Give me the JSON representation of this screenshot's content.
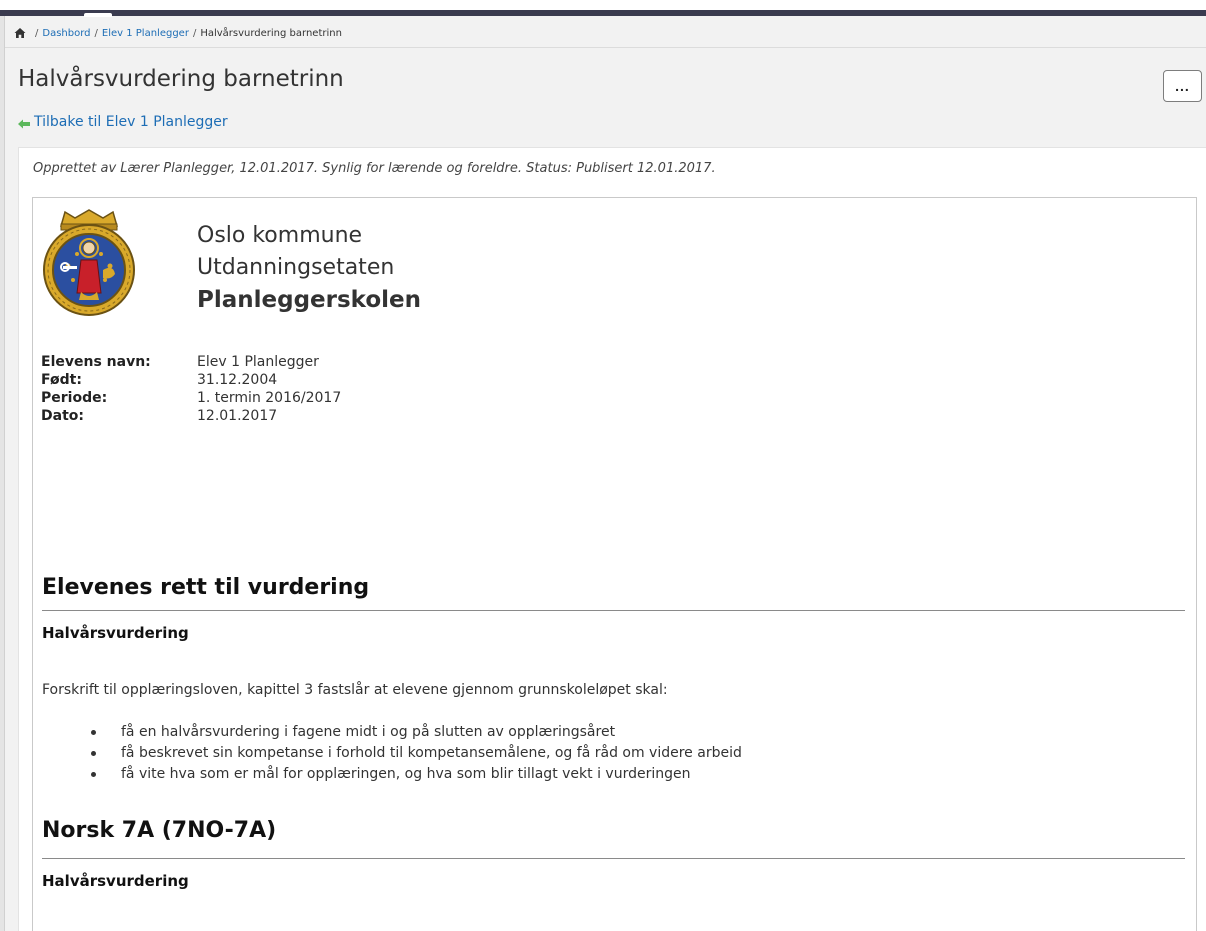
{
  "breadcrumb": {
    "items": [
      "Dashbord",
      "Elev 1 Planlegger"
    ],
    "separator": "/",
    "current": "Halvårsvurdering barnetrinn"
  },
  "page": {
    "title": "Halvårsvurdering barnetrinn",
    "more_label": "...",
    "back_link": "Tilbake til Elev 1 Planlegger"
  },
  "meta": "Opprettet av Lærer Planlegger, 12.01.2017. Synlig for lærende og foreldre. Status: Publisert 12.01.2017.",
  "document": {
    "org": [
      "Oslo kommune",
      "Utdanningsetaten"
    ],
    "school": "Planleggerskolen",
    "info": [
      {
        "label": "Elevens navn:",
        "value": "Elev 1 Planlegger"
      },
      {
        "label": "Født:",
        "value": "31.12.2004"
      },
      {
        "label": "Periode:",
        "value": "1. termin 2016/2017"
      },
      {
        "label": "Dato:",
        "value": "12.01.2017"
      }
    ],
    "sections": [
      {
        "heading": "Elevenes rett til vurdering",
        "subheading": "Halvårsvurdering",
        "intro": "Forskrift til opplæringsloven, kapittel 3 fastslår at elevene gjennom grunnskoleløpet skal:",
        "bullets": [
          "få en halvårsvurdering i fagene midt i og på slutten av opplæringsåret",
          "få beskrevet sin kompetanse i forhold til kompetansemålene, og få råd om videre arbeid",
          "få vite hva som er mål for opplæringen, og hva som blir tillagt vekt i vurderingen"
        ]
      },
      {
        "heading": "Norsk 7A (7NO-7A)",
        "subheading": "Halvårsvurdering"
      }
    ]
  },
  "colors": {
    "link": "#1d6db5",
    "topbar": "#3a3b4f",
    "back_arrow": "#5cb85c",
    "crest_blue": "#2b4fa0",
    "crest_gold": "#d9a92b",
    "crest_red": "#c8202a"
  },
  "icons": {
    "home": "home-icon",
    "back": "arrow-left-icon",
    "more": "more-icon",
    "crest": "oslo-crest-icon"
  }
}
